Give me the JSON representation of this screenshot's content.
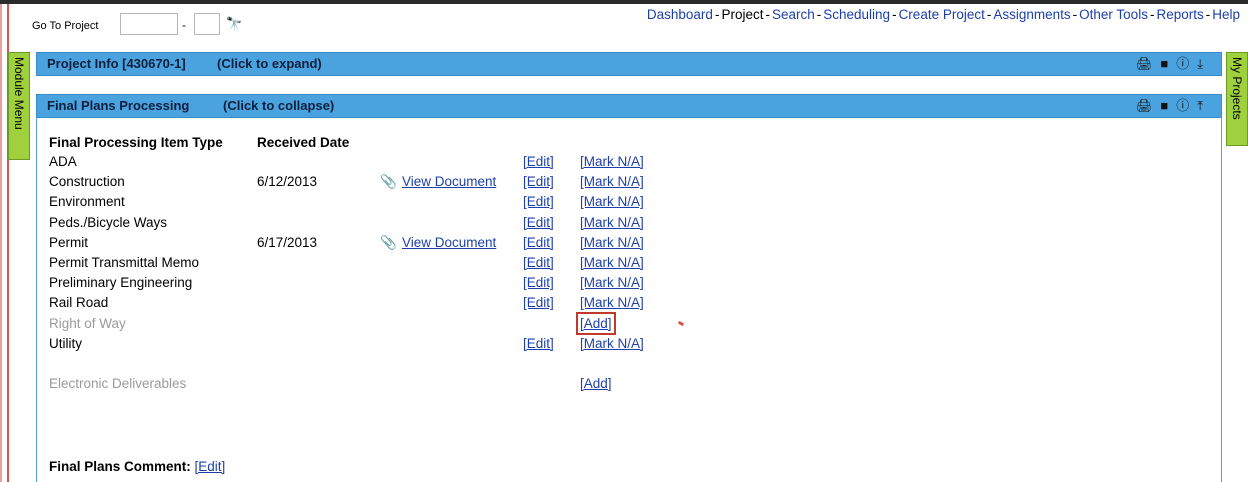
{
  "header": {
    "goto_label": "Go To Project",
    "goto_separator": "-",
    "nav": [
      {
        "label": "Dashboard",
        "current": false
      },
      {
        "label": "Project",
        "current": true
      },
      {
        "label": "Search",
        "current": false
      },
      {
        "label": "Scheduling",
        "current": false
      },
      {
        "label": "Create Project",
        "current": false
      },
      {
        "label": "Assignments",
        "current": false
      },
      {
        "label": "Other Tools",
        "current": false
      },
      {
        "label": "Reports",
        "current": false
      },
      {
        "label": "Help",
        "current": false
      }
    ],
    "nav_separator": "-"
  },
  "side_tabs": {
    "left": "Module Menu",
    "right": "My Projects"
  },
  "project_info_bar": {
    "title": "Project Info [430670-1]",
    "hint": "(Click to expand)"
  },
  "final_plans_bar": {
    "title": "Final Plans Processing",
    "hint": "(Click to collapse)"
  },
  "table": {
    "headers": {
      "type": "Final Processing Item Type",
      "date": "Received Date"
    },
    "rows": [
      {
        "type": "ADA",
        "date": "",
        "doc": "",
        "edit": "[Edit]",
        "action": "[Mark N/A]"
      },
      {
        "type": "Construction",
        "date": "6/12/2013",
        "doc": "View Document",
        "edit": "[Edit]",
        "action": "[Mark N/A]"
      },
      {
        "type": "Environment",
        "date": "",
        "doc": "",
        "edit": "[Edit]",
        "action": "[Mark N/A]"
      },
      {
        "type": "Peds./Bicycle Ways",
        "date": "",
        "doc": "",
        "edit": "[Edit]",
        "action": "[Mark N/A]"
      },
      {
        "type": "Permit",
        "date": "6/17/2013",
        "doc": "View Document",
        "edit": "[Edit]",
        "action": "[Mark N/A]"
      },
      {
        "type": "Permit Transmittal Memo",
        "date": "",
        "doc": "",
        "edit": "[Edit]",
        "action": "[Mark N/A]"
      },
      {
        "type": "Preliminary Engineering",
        "date": "",
        "doc": "",
        "edit": "[Edit]",
        "action": "[Mark N/A]"
      },
      {
        "type": "Rail Road",
        "date": "",
        "doc": "",
        "edit": "[Edit]",
        "action": "[Mark N/A]"
      },
      {
        "type": "Right of Way",
        "date": "",
        "doc": "",
        "edit": "",
        "action": "[Add]",
        "disabled": true
      },
      {
        "type": "Utility",
        "date": "",
        "doc": "",
        "edit": "[Edit]",
        "action": "[Mark N/A]"
      }
    ],
    "extra_row": {
      "type": "Electronic Deliverables",
      "action": "[Add]"
    }
  },
  "comment": {
    "label": "Final Plans Comment:",
    "edit": "[Edit]"
  },
  "colors": {
    "bar": "#4aa3df",
    "tab": "#9fd13f",
    "link": "#1d3fa9"
  }
}
